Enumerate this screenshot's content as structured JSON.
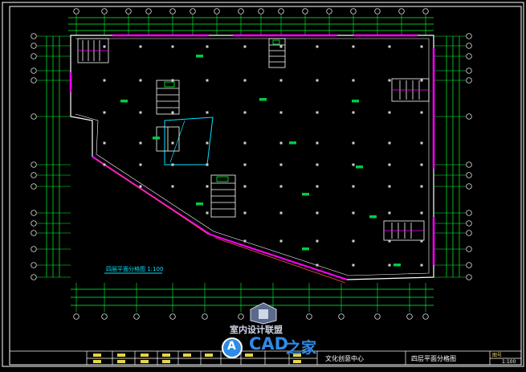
{
  "drawing": {
    "caption": "四层平面分格图 1:100",
    "colors": {
      "background": "#000000",
      "wall": "#ffffff",
      "axis": "#00ff33",
      "dimension": "#00ff33",
      "highlight": "#ff00ff",
      "cyan": "#00e5ff",
      "column": "#cfcfcf",
      "label": "#00cc44"
    }
  },
  "title_block": {
    "project_name": "文化创意中心",
    "drawing_title": "四层平面分格图",
    "sheet_no_label": "图号",
    "scale": "1:100"
  },
  "watermark": {
    "site_cn": "室内设计联盟",
    "brand_latin": "CAD",
    "brand_cn": "之家",
    "brand_letter": "A"
  }
}
